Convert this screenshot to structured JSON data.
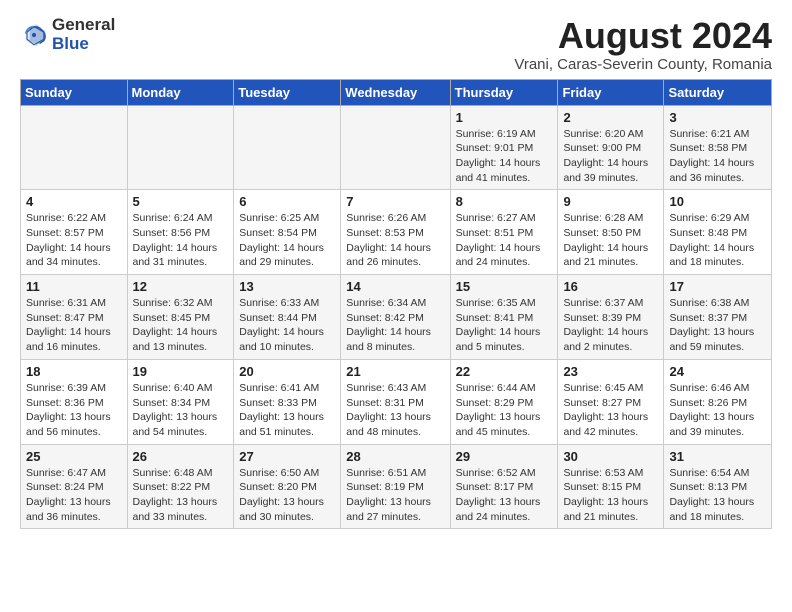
{
  "logo": {
    "general": "General",
    "blue": "Blue"
  },
  "title": {
    "month_year": "August 2024",
    "location": "Vrani, Caras-Severin County, Romania"
  },
  "weekdays": [
    "Sunday",
    "Monday",
    "Tuesday",
    "Wednesday",
    "Thursday",
    "Friday",
    "Saturday"
  ],
  "weeks": [
    [
      {
        "day": "",
        "info": ""
      },
      {
        "day": "",
        "info": ""
      },
      {
        "day": "",
        "info": ""
      },
      {
        "day": "",
        "info": ""
      },
      {
        "day": "1",
        "info": "Sunrise: 6:19 AM\nSunset: 9:01 PM\nDaylight: 14 hours and 41 minutes."
      },
      {
        "day": "2",
        "info": "Sunrise: 6:20 AM\nSunset: 9:00 PM\nDaylight: 14 hours and 39 minutes."
      },
      {
        "day": "3",
        "info": "Sunrise: 6:21 AM\nSunset: 8:58 PM\nDaylight: 14 hours and 36 minutes."
      }
    ],
    [
      {
        "day": "4",
        "info": "Sunrise: 6:22 AM\nSunset: 8:57 PM\nDaylight: 14 hours and 34 minutes."
      },
      {
        "day": "5",
        "info": "Sunrise: 6:24 AM\nSunset: 8:56 PM\nDaylight: 14 hours and 31 minutes."
      },
      {
        "day": "6",
        "info": "Sunrise: 6:25 AM\nSunset: 8:54 PM\nDaylight: 14 hours and 29 minutes."
      },
      {
        "day": "7",
        "info": "Sunrise: 6:26 AM\nSunset: 8:53 PM\nDaylight: 14 hours and 26 minutes."
      },
      {
        "day": "8",
        "info": "Sunrise: 6:27 AM\nSunset: 8:51 PM\nDaylight: 14 hours and 24 minutes."
      },
      {
        "day": "9",
        "info": "Sunrise: 6:28 AM\nSunset: 8:50 PM\nDaylight: 14 hours and 21 minutes."
      },
      {
        "day": "10",
        "info": "Sunrise: 6:29 AM\nSunset: 8:48 PM\nDaylight: 14 hours and 18 minutes."
      }
    ],
    [
      {
        "day": "11",
        "info": "Sunrise: 6:31 AM\nSunset: 8:47 PM\nDaylight: 14 hours and 16 minutes."
      },
      {
        "day": "12",
        "info": "Sunrise: 6:32 AM\nSunset: 8:45 PM\nDaylight: 14 hours and 13 minutes."
      },
      {
        "day": "13",
        "info": "Sunrise: 6:33 AM\nSunset: 8:44 PM\nDaylight: 14 hours and 10 minutes."
      },
      {
        "day": "14",
        "info": "Sunrise: 6:34 AM\nSunset: 8:42 PM\nDaylight: 14 hours and 8 minutes."
      },
      {
        "day": "15",
        "info": "Sunrise: 6:35 AM\nSunset: 8:41 PM\nDaylight: 14 hours and 5 minutes."
      },
      {
        "day": "16",
        "info": "Sunrise: 6:37 AM\nSunset: 8:39 PM\nDaylight: 14 hours and 2 minutes."
      },
      {
        "day": "17",
        "info": "Sunrise: 6:38 AM\nSunset: 8:37 PM\nDaylight: 13 hours and 59 minutes."
      }
    ],
    [
      {
        "day": "18",
        "info": "Sunrise: 6:39 AM\nSunset: 8:36 PM\nDaylight: 13 hours and 56 minutes."
      },
      {
        "day": "19",
        "info": "Sunrise: 6:40 AM\nSunset: 8:34 PM\nDaylight: 13 hours and 54 minutes."
      },
      {
        "day": "20",
        "info": "Sunrise: 6:41 AM\nSunset: 8:33 PM\nDaylight: 13 hours and 51 minutes."
      },
      {
        "day": "21",
        "info": "Sunrise: 6:43 AM\nSunset: 8:31 PM\nDaylight: 13 hours and 48 minutes."
      },
      {
        "day": "22",
        "info": "Sunrise: 6:44 AM\nSunset: 8:29 PM\nDaylight: 13 hours and 45 minutes."
      },
      {
        "day": "23",
        "info": "Sunrise: 6:45 AM\nSunset: 8:27 PM\nDaylight: 13 hours and 42 minutes."
      },
      {
        "day": "24",
        "info": "Sunrise: 6:46 AM\nSunset: 8:26 PM\nDaylight: 13 hours and 39 minutes."
      }
    ],
    [
      {
        "day": "25",
        "info": "Sunrise: 6:47 AM\nSunset: 8:24 PM\nDaylight: 13 hours and 36 minutes."
      },
      {
        "day": "26",
        "info": "Sunrise: 6:48 AM\nSunset: 8:22 PM\nDaylight: 13 hours and 33 minutes."
      },
      {
        "day": "27",
        "info": "Sunrise: 6:50 AM\nSunset: 8:20 PM\nDaylight: 13 hours and 30 minutes."
      },
      {
        "day": "28",
        "info": "Sunrise: 6:51 AM\nSunset: 8:19 PM\nDaylight: 13 hours and 27 minutes."
      },
      {
        "day": "29",
        "info": "Sunrise: 6:52 AM\nSunset: 8:17 PM\nDaylight: 13 hours and 24 minutes."
      },
      {
        "day": "30",
        "info": "Sunrise: 6:53 AM\nSunset: 8:15 PM\nDaylight: 13 hours and 21 minutes."
      },
      {
        "day": "31",
        "info": "Sunrise: 6:54 AM\nSunset: 8:13 PM\nDaylight: 13 hours and 18 minutes."
      }
    ]
  ]
}
